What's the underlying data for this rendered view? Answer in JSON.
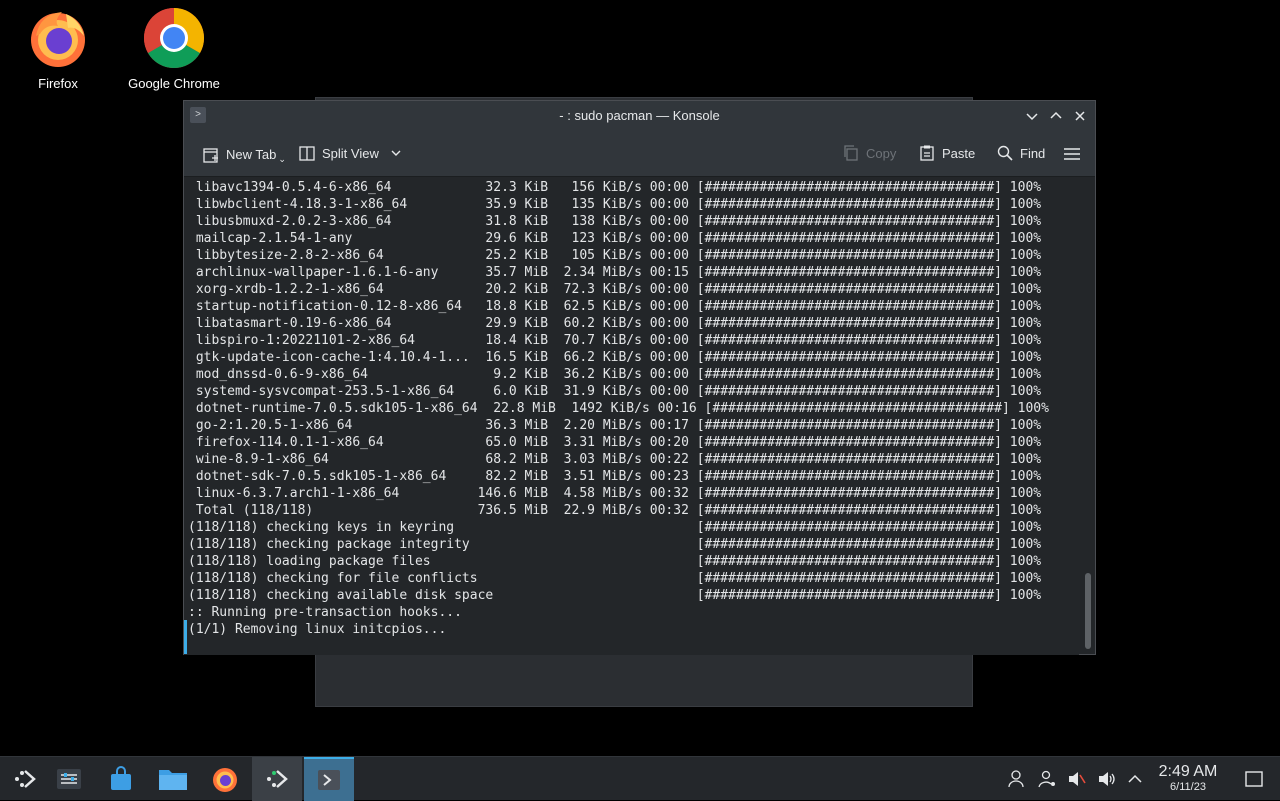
{
  "desktop": {
    "icons": [
      {
        "label": "Firefox"
      },
      {
        "label": "Google Chrome"
      }
    ]
  },
  "window": {
    "title": "- : sudo pacman — Konsole",
    "toolbar": {
      "new_tab": "New Tab",
      "split_view": "Split View",
      "copy": "Copy",
      "paste": "Paste",
      "find": "Find"
    }
  },
  "terminal": {
    "lines": [
      " libavc1394-0.5.4-6-x86_64            32.3 KiB   156 KiB/s 00:00 [#####################################] 100%",
      " libwbclient-4.18.3-1-x86_64          35.9 KiB   135 KiB/s 00:00 [#####################################] 100%",
      " libusbmuxd-2.0.2-3-x86_64            31.8 KiB   138 KiB/s 00:00 [#####################################] 100%",
      " mailcap-2.1.54-1-any                 29.6 KiB   123 KiB/s 00:00 [#####################################] 100%",
      " libbytesize-2.8-2-x86_64             25.2 KiB   105 KiB/s 00:00 [#####################################] 100%",
      " archlinux-wallpaper-1.6.1-6-any      35.7 MiB  2.34 MiB/s 00:15 [#####################################] 100%",
      " xorg-xrdb-1.2.2-1-x86_64             20.2 KiB  72.3 KiB/s 00:00 [#####################################] 100%",
      " startup-notification-0.12-8-x86_64   18.8 KiB  62.5 KiB/s 00:00 [#####################################] 100%",
      " libatasmart-0.19-6-x86_64            29.9 KiB  60.2 KiB/s 00:00 [#####################################] 100%",
      " libspiro-1:20221101-2-x86_64         18.4 KiB  70.7 KiB/s 00:00 [#####################################] 100%",
      " gtk-update-icon-cache-1:4.10.4-1...  16.5 KiB  66.2 KiB/s 00:00 [#####################################] 100%",
      " mod_dnssd-0.6-9-x86_64                9.2 KiB  36.2 KiB/s 00:00 [#####################################] 100%",
      " systemd-sysvcompat-253.5-1-x86_64     6.0 KiB  31.9 KiB/s 00:00 [#####################################] 100%",
      " dotnet-runtime-7.0.5.sdk105-1-x86_64  22.8 MiB  1492 KiB/s 00:16 [#####################################] 100%",
      " go-2:1.20.5-1-x86_64                 36.3 MiB  2.20 MiB/s 00:17 [#####################################] 100%",
      " firefox-114.0.1-1-x86_64             65.0 MiB  3.31 MiB/s 00:20 [#####################################] 100%",
      " wine-8.9-1-x86_64                    68.2 MiB  3.03 MiB/s 00:22 [#####################################] 100%",
      " dotnet-sdk-7.0.5.sdk105-1-x86_64     82.2 MiB  3.51 MiB/s 00:23 [#####################################] 100%",
      " linux-6.3.7.arch1-1-x86_64          146.6 MiB  4.58 MiB/s 00:32 [#####################################] 100%",
      " Total (118/118)                     736.5 MiB  22.9 MiB/s 00:32 [#####################################] 100%",
      "(118/118) checking keys in keyring                               [#####################################] 100%",
      "(118/118) checking package integrity                             [#####################################] 100%",
      "(118/118) loading package files                                  [#####################################] 100%",
      "(118/118) checking for file conflicts                            [#####################################] 100%",
      "(118/118) checking available disk space                          [#####################################] 100%",
      ":: Running pre-transaction hooks...",
      "(1/1) Removing linux initcpios..."
    ]
  },
  "taskbar": {
    "clock_time": "2:49 AM",
    "clock_date": "6/11/23"
  },
  "colors": {
    "accent": "#3daee9",
    "terminal_bg": "#232629",
    "titlebar_bg": "#31363b"
  }
}
